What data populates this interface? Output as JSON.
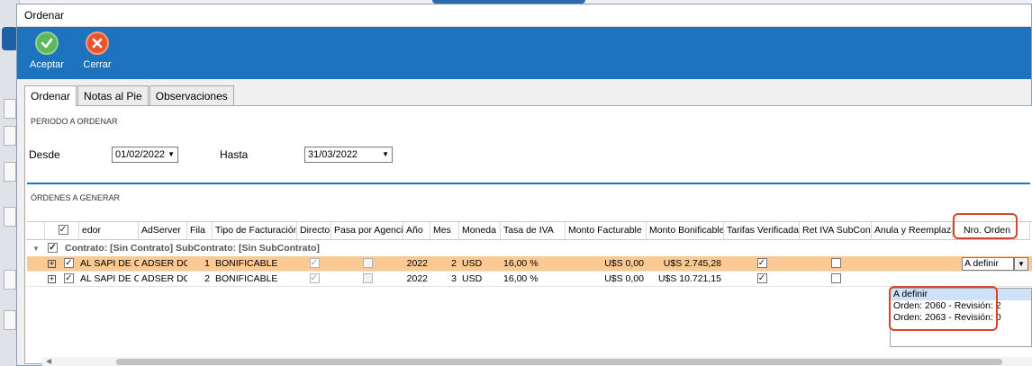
{
  "window": {
    "title": "Ordenar"
  },
  "toolbar": {
    "accept_label": "Aceptar",
    "close_label": "Cerrar"
  },
  "tabs": [
    {
      "label": "Ordenar",
      "active": true
    },
    {
      "label": "Notas al Pie",
      "active": false
    },
    {
      "label": "Observaciones",
      "active": false
    }
  ],
  "period": {
    "section_title": "PERIODO A ORDENAR",
    "from_label": "Desde",
    "from_value": "01/02/2022",
    "to_label": "Hasta",
    "to_value": "31/03/2022"
  },
  "orders": {
    "section_title": "ÓRDENES A GENERAR",
    "columns": [
      "",
      "edor",
      "AdServer",
      "Fila",
      "Tipo de Facturación",
      "Directo",
      "Pasa por Agencia",
      "Año",
      "Mes",
      "Moneda",
      "Tasa de IVA",
      "Monto Facturable",
      "Monto Bonificable",
      "Tarifas Verificadas",
      "Ret IVA SubCont",
      "Anula y Reemplaza",
      "Nro. Orden"
    ],
    "group_label": "Contrato: [Sin Contrato]   SubContrato: [Sin SubContrato]",
    "rows": [
      {
        "proveedor": "AL SAPI DE CV",
        "adserver": "ADSER DOL",
        "fila": "1",
        "tipo": "BONIFICABLE",
        "anio": "2022",
        "mes": "2",
        "moneda": "USD",
        "tasa_iva": "16,00 %",
        "monto_facturable": "U$S 0,00",
        "monto_bonificable": "U$S 2.745,28",
        "nro_orden": "A definir"
      },
      {
        "proveedor": "AL SAPI DE CV",
        "adserver": "ADSER DOL",
        "fila": "2",
        "tipo": "BONIFICABLE",
        "anio": "2022",
        "mes": "3",
        "moneda": "USD",
        "tasa_iva": "16,00 %",
        "monto_facturable": "U$S 0,00",
        "monto_bonificable": "U$S 10.721,15",
        "nro_orden": ""
      }
    ],
    "dropdown_options": [
      "A definir",
      "Orden: 2060 - Revisión: 2",
      "Orden: 2063 - Revisión: 0"
    ]
  },
  "colors": {
    "ribbon": "#1e73be",
    "selected_row": "#fbc996",
    "highlight_box": "#d6452e"
  }
}
